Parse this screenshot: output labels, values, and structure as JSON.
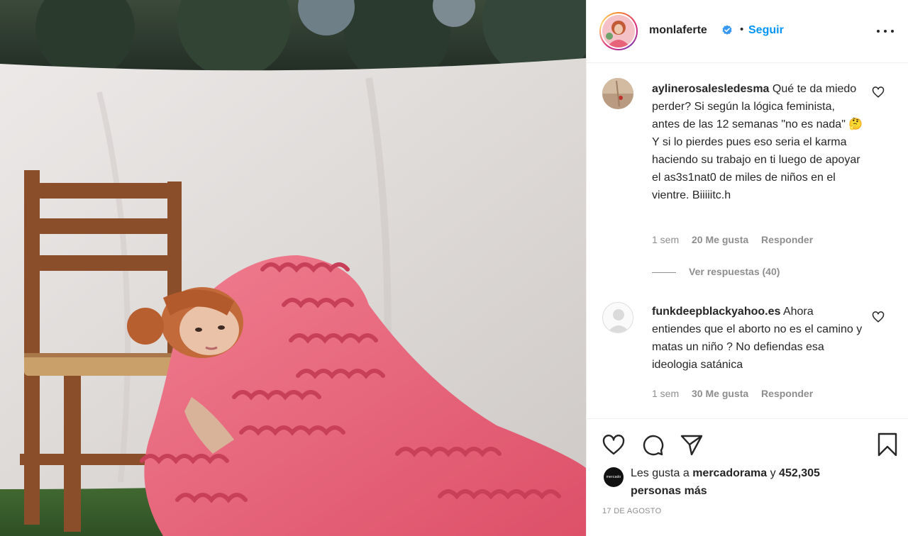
{
  "post": {
    "author": {
      "username": "monlaferte",
      "verified": true,
      "follow_label": "Seguir",
      "separator": "•"
    },
    "comments": [
      {
        "username": "aylinerosalesledesma",
        "text": "Qué te da miedo perder? Si según la lógica feminista, antes de las 12 semanas \"no es nada\" 🤔 Y si lo pierdes pues eso seria el karma haciendo su trabajo en ti luego de apoyar el as3s1nat0 de miles de niños en el vientre. Biiiiitc.h",
        "time": "1 sem",
        "likes": "20 Me gusta",
        "reply_label": "Responder",
        "view_replies": "Ver respuestas (40)"
      },
      {
        "username": "funkdeepblackyahoo.es",
        "text": "Ahora entiendes que el aborto no es el camino y matas un niño ? No defiendas esa ideologia satánica",
        "time": "1 sem",
        "likes": "30 Me gusta",
        "reply_label": "Responder"
      }
    ],
    "likes": {
      "prefix": "Les gusta a",
      "user": "mercadorama",
      "conjunction": "y",
      "count_text": "452,305 personas más",
      "avatar_text": "mercado"
    },
    "date": "17 DE AGOSTO",
    "icons": [
      "heart-icon",
      "comment-icon",
      "share-icon",
      "bookmark-icon",
      "more-options-icon",
      "verified-badge-icon"
    ],
    "colors": {
      "follow": "#0095f6",
      "text": "#262626",
      "muted": "#8e8e8e",
      "verified": "#3897f0",
      "dress": "#e8637a"
    }
  }
}
